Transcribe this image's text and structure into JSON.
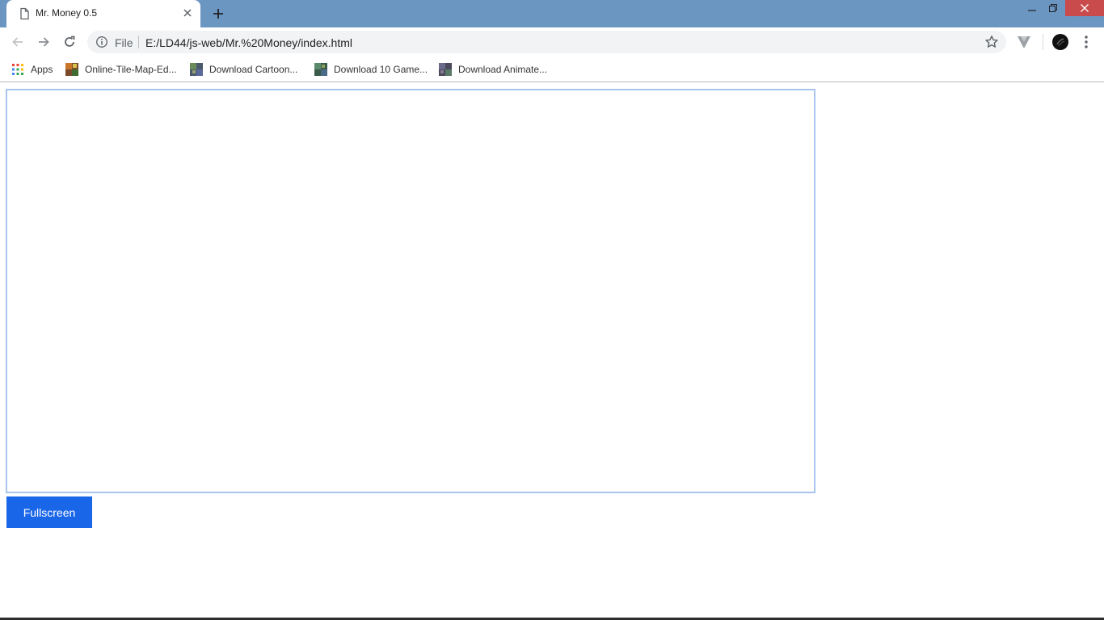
{
  "browser": {
    "tab": {
      "title": "Mr. Money 0.5",
      "favicon": "page-icon"
    },
    "address": {
      "scheme_label": "File",
      "url": "E:/LD44/js-web/Mr.%20Money/index.html"
    },
    "bookmarks": [
      {
        "label": "Apps",
        "icon": "apps-grid-icon"
      },
      {
        "label": "Online-Tile-Map-Ed...",
        "icon": "site-thumbnail-icon"
      },
      {
        "label": "Download Cartoon...",
        "icon": "site-thumbnail-icon"
      },
      {
        "label": "Download 10 Game...",
        "icon": "site-thumbnail-icon"
      },
      {
        "label": "Download Animate...",
        "icon": "site-thumbnail-icon"
      }
    ]
  },
  "page": {
    "fullscreen_label": "Fullscreen"
  },
  "colors": {
    "titlebar": "#6b96c1",
    "close_button": "#c94b4b",
    "primary_button": "#1a66e8",
    "canvas_border": "#a9c4ef"
  }
}
